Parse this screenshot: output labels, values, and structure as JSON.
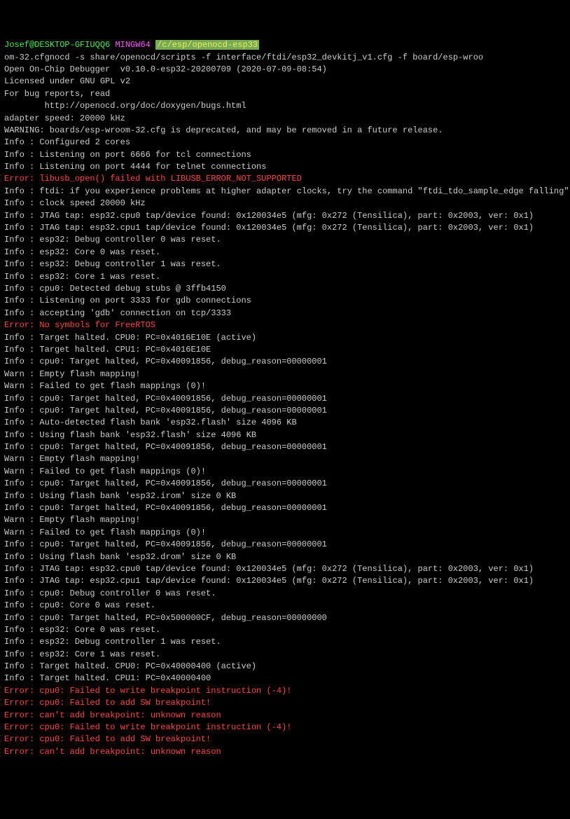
{
  "prompt": {
    "user": "Josef",
    "at": "@",
    "host": "DESKTOP-GFIUQQ6",
    "shell": "MINGW64",
    "path": "/c/esp/openocd-esp33"
  },
  "command": "om-32.cfgnocd -s share/openocd/scripts -f interface/ftdi/esp32_devkitj_v1.cfg -f board/esp-wroo",
  "header": [
    "Open On-Chip Debugger  v0.10.0-esp32-20200709 (2020-07-09-08:54)",
    "Licensed under GNU GPL v2",
    "For bug reports, read",
    "        http://openocd.org/doc/doxygen/bugs.html",
    "adapter speed: 20000 kHz",
    ""
  ],
  "warning": "WARNING: boards/esp-wroom-32.cfg is deprecated, and may be removed in a future release.",
  "log": [
    {
      "p": "Info :",
      "t": "Configured 2 cores"
    },
    {
      "p": "Info :",
      "t": "Listening on port 6666 for tcl connections"
    },
    {
      "p": "Info :",
      "t": "Listening on port 4444 for telnet connections"
    },
    {
      "p": "Error:",
      "t": "libusb_open() failed with LIBUSB_ERROR_NOT_SUPPORTED",
      "e": true
    },
    {
      "p": "Info :",
      "t": "ftdi: if you experience problems at higher adapter clocks, try the command \"ftdi_tdo_sample_edge falling\""
    },
    {
      "p": "Info :",
      "t": "clock speed 20000 kHz"
    },
    {
      "p": "Info :",
      "t": "JTAG tap: esp32.cpu0 tap/device found: 0x120034e5 (mfg: 0x272 (Tensilica), part: 0x2003, ver: 0x1)"
    },
    {
      "p": "Info :",
      "t": "JTAG tap: esp32.cpu1 tap/device found: 0x120034e5 (mfg: 0x272 (Tensilica), part: 0x2003, ver: 0x1)"
    },
    {
      "p": "Info :",
      "t": "esp32: Debug controller 0 was reset."
    },
    {
      "p": "Info :",
      "t": "esp32: Core 0 was reset."
    },
    {
      "p": "Info :",
      "t": "esp32: Debug controller 1 was reset."
    },
    {
      "p": "Info :",
      "t": "esp32: Core 1 was reset."
    },
    {
      "p": "Info :",
      "t": "cpu0: Detected debug stubs @ 3ffb4150"
    },
    {
      "p": "Info :",
      "t": "Listening on port 3333 for gdb connections"
    },
    {
      "p": "Info :",
      "t": "accepting 'gdb' connection on tcp/3333"
    },
    {
      "p": "Error:",
      "t": "No symbols for FreeRTOS",
      "e": true
    },
    {
      "p": "Info :",
      "t": "Target halted. CPU0: PC=0x4016E10E (active)"
    },
    {
      "p": "Info :",
      "t": "Target halted. CPU1: PC=0x4016E10E"
    },
    {
      "p": "Info :",
      "t": "cpu0: Target halted, PC=0x40091856, debug_reason=00000001"
    },
    {
      "p": "Warn :",
      "t": "Empty flash mapping!"
    },
    {
      "p": "Warn :",
      "t": "Failed to get flash mappings (0)!"
    },
    {
      "p": "Info :",
      "t": "cpu0: Target halted, PC=0x40091856, debug_reason=00000001"
    },
    {
      "p": "Info :",
      "t": "cpu0: Target halted, PC=0x40091856, debug_reason=00000001"
    },
    {
      "p": "Info :",
      "t": "Auto-detected flash bank 'esp32.flash' size 4096 KB"
    },
    {
      "p": "Info :",
      "t": "Using flash bank 'esp32.flash' size 4096 KB"
    },
    {
      "p": "Info :",
      "t": "cpu0: Target halted, PC=0x40091856, debug_reason=00000001"
    },
    {
      "p": "Warn :",
      "t": "Empty flash mapping!"
    },
    {
      "p": "Warn :",
      "t": "Failed to get flash mappings (0)!"
    },
    {
      "p": "Info :",
      "t": "cpu0: Target halted, PC=0x40091856, debug_reason=00000001"
    },
    {
      "p": "Info :",
      "t": "Using flash bank 'esp32.irom' size 0 KB"
    },
    {
      "p": "Info :",
      "t": "cpu0: Target halted, PC=0x40091856, debug_reason=00000001"
    },
    {
      "p": "Warn :",
      "t": "Empty flash mapping!"
    },
    {
      "p": "Warn :",
      "t": "Failed to get flash mappings (0)!"
    },
    {
      "p": "Info :",
      "t": "cpu0: Target halted, PC=0x40091856, debug_reason=00000001"
    },
    {
      "p": "Info :",
      "t": "Using flash bank 'esp32.drom' size 0 KB"
    },
    {
      "p": "Info :",
      "t": "JTAG tap: esp32.cpu0 tap/device found: 0x120034e5 (mfg: 0x272 (Tensilica), part: 0x2003, ver: 0x1)"
    },
    {
      "p": "Info :",
      "t": "JTAG tap: esp32.cpu1 tap/device found: 0x120034e5 (mfg: 0x272 (Tensilica), part: 0x2003, ver: 0x1)"
    },
    {
      "p": "Info :",
      "t": "cpu0: Debug controller 0 was reset."
    },
    {
      "p": "Info :",
      "t": "cpu0: Core 0 was reset."
    },
    {
      "p": "Info :",
      "t": "cpu0: Target halted, PC=0x500000CF, debug_reason=00000000"
    },
    {
      "p": "Info :",
      "t": "esp32: Core 0 was reset."
    },
    {
      "p": "Info :",
      "t": "esp32: Debug controller 1 was reset."
    },
    {
      "p": "Info :",
      "t": "esp32: Core 1 was reset."
    },
    {
      "p": "Info :",
      "t": "Target halted. CPU0: PC=0x40000400 (active)"
    },
    {
      "p": "Info :",
      "t": "Target halted. CPU1: PC=0x40000400"
    },
    {
      "p": "Error:",
      "t": "cpu0: Failed to write breakpoint instruction (-4)!",
      "e": true
    },
    {
      "p": "Error:",
      "t": "cpu0: Failed to add SW breakpoint!",
      "e": true
    },
    {
      "p": "Error:",
      "t": "can't add breakpoint: unknown reason",
      "e": true
    },
    {
      "p": "Error:",
      "t": "cpu0: Failed to write breakpoint instruction (-4)!",
      "e": true
    },
    {
      "p": "Error:",
      "t": "cpu0: Failed to add SW breakpoint!",
      "e": true
    },
    {
      "p": "Error:",
      "t": "can't add breakpoint: unknown reason",
      "e": true
    }
  ]
}
